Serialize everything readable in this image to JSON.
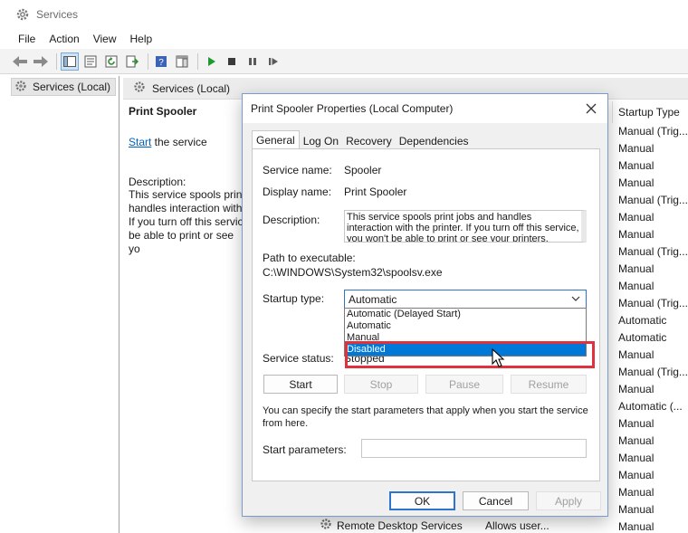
{
  "window": {
    "title": "Services",
    "menu": [
      "File",
      "Action",
      "View",
      "Help"
    ]
  },
  "tree": {
    "root_label": "Services (Local)"
  },
  "right_pane": {
    "header": "Services (Local)",
    "service_title": "Print Spooler",
    "start_link": "Start",
    "start_suffix": " the service",
    "description_label": "Description:",
    "description_partial": "This service spools print\nhandles interaction with\nIf you turn off this servic\nbe able to print or see yo",
    "column_header": "Startup Type",
    "startup_types": [
      "Manual (Trig...",
      "Manual",
      "Manual",
      "Manual",
      "Manual (Trig...",
      "Manual",
      "Manual",
      "Manual (Trig...",
      "Manual",
      "Manual",
      "Manual (Trig...",
      "Automatic",
      "Automatic",
      "Manual",
      "Manual (Trig...",
      "Manual",
      "Automatic (...",
      "Manual",
      "Manual",
      "Manual",
      "Manual",
      "Manual",
      "Manual",
      "Manual"
    ],
    "bottom_service": {
      "name": "Remote Desktop Services",
      "description": "Allows user..."
    }
  },
  "dialog": {
    "title": "Print Spooler Properties (Local Computer)",
    "tabs": [
      "General",
      "Log On",
      "Recovery",
      "Dependencies"
    ],
    "active_tab": "General",
    "service_name_label": "Service name:",
    "service_name": "Spooler",
    "display_name_label": "Display name:",
    "display_name": "Print Spooler",
    "description_label": "Description:",
    "description": "This service spools print jobs and handles interaction with the printer.  If you turn off this service, you won't be able to print or see your printers.",
    "path_label": "Path to executable:",
    "path": "C:\\WINDOWS\\System32\\spoolsv.exe",
    "startup_type_label": "Startup type:",
    "startup_type_value": "Automatic",
    "startup_options": [
      "Automatic (Delayed Start)",
      "Automatic",
      "Manual",
      "Disabled"
    ],
    "highlighted_option": "Disabled",
    "service_status_label": "Service status:",
    "service_status": "Stopped",
    "control_buttons": {
      "start": "Start",
      "stop": "Stop",
      "pause": "Pause",
      "resume": "Resume"
    },
    "info_text": "You can specify the start parameters that apply when you start the service from here.",
    "start_params_label": "Start parameters:",
    "start_params_value": "",
    "footer_buttons": {
      "ok": "OK",
      "cancel": "Cancel",
      "apply": "Apply"
    }
  },
  "colors": {
    "accent": "#0078d7",
    "highlight_box": "#e0313e",
    "link": "#0060c0"
  }
}
